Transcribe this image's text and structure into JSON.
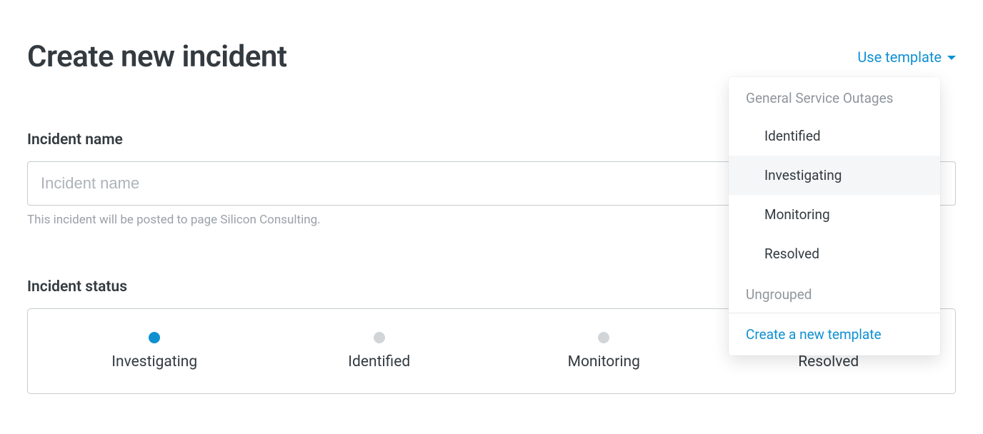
{
  "header": {
    "title": "Create new incident",
    "use_template_label": "Use template"
  },
  "form": {
    "name_section_label": "Incident name",
    "name_placeholder": "Incident name",
    "name_value": "",
    "helper_text": "This incident will be posted to page Silicon Consulting."
  },
  "status": {
    "section_label": "Incident status",
    "options": [
      {
        "label": "Investigating",
        "active": true
      },
      {
        "label": "Identified",
        "active": false
      },
      {
        "label": "Monitoring",
        "active": false
      },
      {
        "label": "Resolved",
        "active": false
      }
    ]
  },
  "template_dropdown": {
    "groups": [
      {
        "label": "General Service Outages",
        "items": [
          {
            "label": "Identified",
            "highlighted": false
          },
          {
            "label": "Investigating",
            "highlighted": true
          },
          {
            "label": "Monitoring",
            "highlighted": false
          },
          {
            "label": "Resolved",
            "highlighted": false
          }
        ]
      },
      {
        "label": "Ungrouped",
        "items": []
      }
    ],
    "create_label": "Create a new template"
  }
}
